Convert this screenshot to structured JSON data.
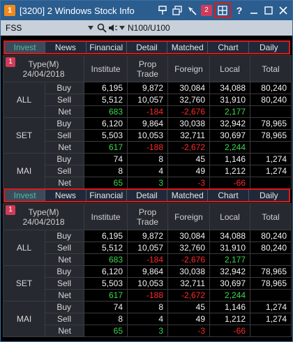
{
  "window": {
    "badge": "1",
    "title": "[3200] 2 Windows Stock Info",
    "notify_badge": "2"
  },
  "search": {
    "symbol": "FSS",
    "market_label": "N100/U100"
  },
  "tabs": [
    "Invest",
    "News",
    "Financial",
    "Detail",
    "Matched",
    "Chart",
    "Daily"
  ],
  "active_tab_color": "#4cc0a0",
  "colors": {
    "positive": "#3bd94b",
    "negative": "#ff2a2a",
    "title_bar": "#2b5d8f"
  },
  "panels": [
    {
      "badge": "1",
      "type_label": "Type(M)",
      "date": "24/04/2018",
      "columns": [
        "Institute",
        "Prop Trade",
        "Foreign",
        "Local",
        "Total"
      ],
      "groups": [
        {
          "name": "ALL",
          "rows": [
            {
              "label": "Buy",
              "values": [
                "6,195",
                "9,872",
                "30,084",
                "34,088",
                "80,240"
              ]
            },
            {
              "label": "Sell",
              "values": [
                "5,512",
                "10,057",
                "32,760",
                "31,910",
                "80,240"
              ]
            },
            {
              "label": "Net",
              "values": [
                "683",
                "-184",
                "-2,676",
                "2,177",
                ""
              ]
            }
          ]
        },
        {
          "name": "SET",
          "rows": [
            {
              "label": "Buy",
              "values": [
                "6,120",
                "9,864",
                "30,038",
                "32,942",
                "78,965"
              ]
            },
            {
              "label": "Sell",
              "values": [
                "5,503",
                "10,053",
                "32,711",
                "30,697",
                "78,965"
              ]
            },
            {
              "label": "Net",
              "values": [
                "617",
                "-188",
                "-2,672",
                "2,244",
                ""
              ]
            }
          ]
        },
        {
          "name": "MAI",
          "rows": [
            {
              "label": "Buy",
              "values": [
                "74",
                "8",
                "45",
                "1,146",
                "1,274"
              ]
            },
            {
              "label": "Sell",
              "values": [
                "8",
                "4",
                "49",
                "1,212",
                "1,274"
              ]
            },
            {
              "label": "Net",
              "values": [
                "65",
                "3",
                "-3",
                "-66",
                ""
              ]
            }
          ]
        }
      ]
    },
    {
      "badge": "1",
      "type_label": "Type(M)",
      "date": "24/04/2018",
      "columns": [
        "Institute",
        "Prop Trade",
        "Foreign",
        "Local",
        "Total"
      ],
      "groups": [
        {
          "name": "ALL",
          "rows": [
            {
              "label": "Buy",
              "values": [
                "6,195",
                "9,872",
                "30,084",
                "34,088",
                "80,240"
              ]
            },
            {
              "label": "Sell",
              "values": [
                "5,512",
                "10,057",
                "32,760",
                "31,910",
                "80,240"
              ]
            },
            {
              "label": "Net",
              "values": [
                "683",
                "-184",
                "-2,676",
                "2,177",
                ""
              ]
            }
          ]
        },
        {
          "name": "SET",
          "rows": [
            {
              "label": "Buy",
              "values": [
                "6,120",
                "9,864",
                "30,038",
                "32,942",
                "78,965"
              ]
            },
            {
              "label": "Sell",
              "values": [
                "5,503",
                "10,053",
                "32,711",
                "30,697",
                "78,965"
              ]
            },
            {
              "label": "Net",
              "values": [
                "617",
                "-188",
                "-2,672",
                "2,244",
                ""
              ]
            }
          ]
        },
        {
          "name": "MAI",
          "rows": [
            {
              "label": "Buy",
              "values": [
                "74",
                "8",
                "45",
                "1,146",
                "1,274"
              ]
            },
            {
              "label": "Sell",
              "values": [
                "8",
                "4",
                "49",
                "1,212",
                "1,274"
              ]
            },
            {
              "label": "Net",
              "values": [
                "65",
                "3",
                "-3",
                "-66",
                ""
              ]
            }
          ]
        }
      ]
    }
  ]
}
